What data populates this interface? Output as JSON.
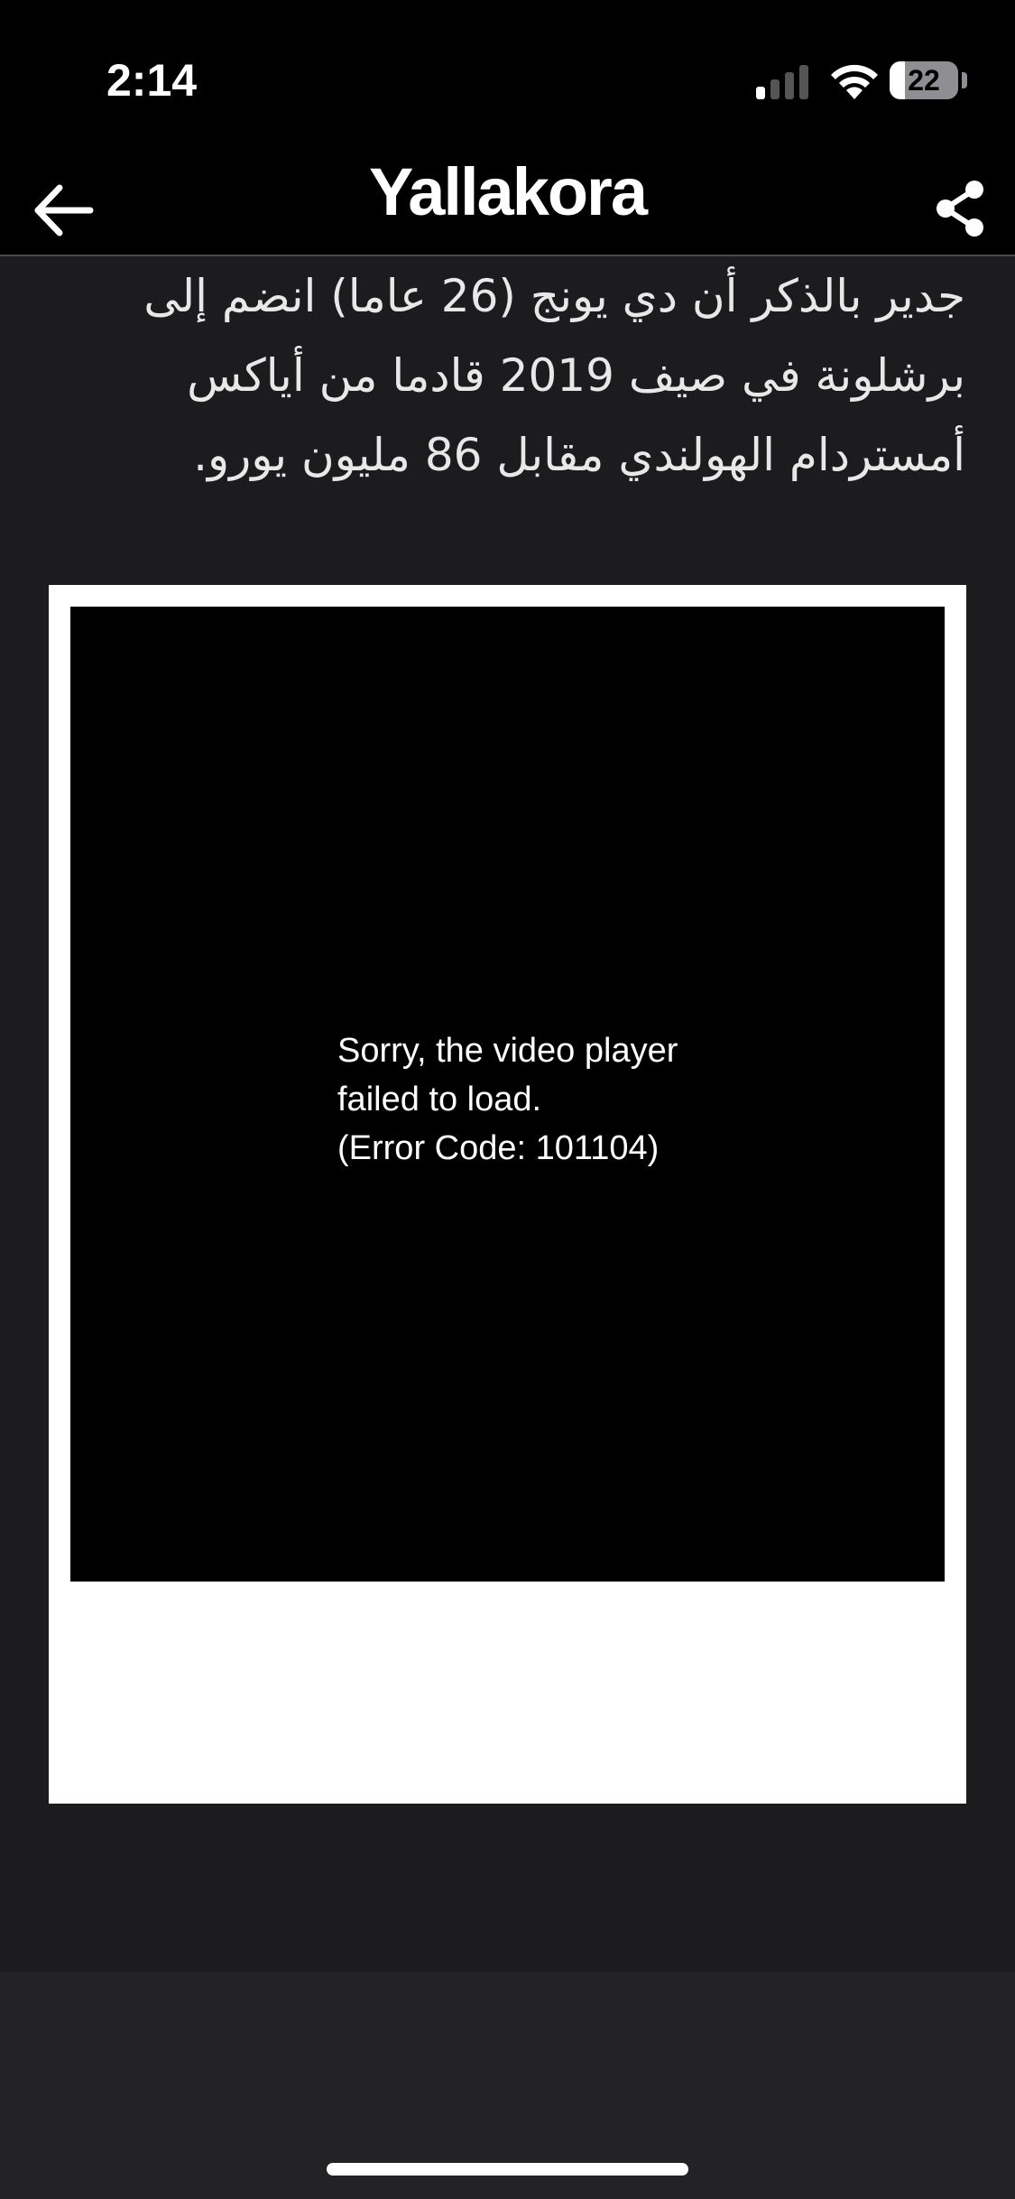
{
  "status_bar": {
    "time": "2:14",
    "battery_level": "22",
    "battery_fraction": 0.22,
    "signal_bars_active": 1
  },
  "nav": {
    "brand": "Yallakora",
    "back_icon": "arrow-left-icon",
    "share_icon": "share-icon"
  },
  "article": {
    "paragraph_lines": [
      "جدير بالذكر أن دي يونج (26 عاما) انضم إلى",
      "برشلونة في صيف 2019 قادما من أياكس",
      "أمستردام الهولندي مقابل 86 مليون يورو."
    ]
  },
  "video": {
    "error_lines": [
      "Sorry, the video player",
      "failed to load.",
      "(Error Code: 101104)"
    ]
  },
  "colors": {
    "page_bg": "#1c1c1e",
    "bars_bg": "#000000",
    "frame_bg": "#ffffff",
    "player_bg": "#000000"
  }
}
